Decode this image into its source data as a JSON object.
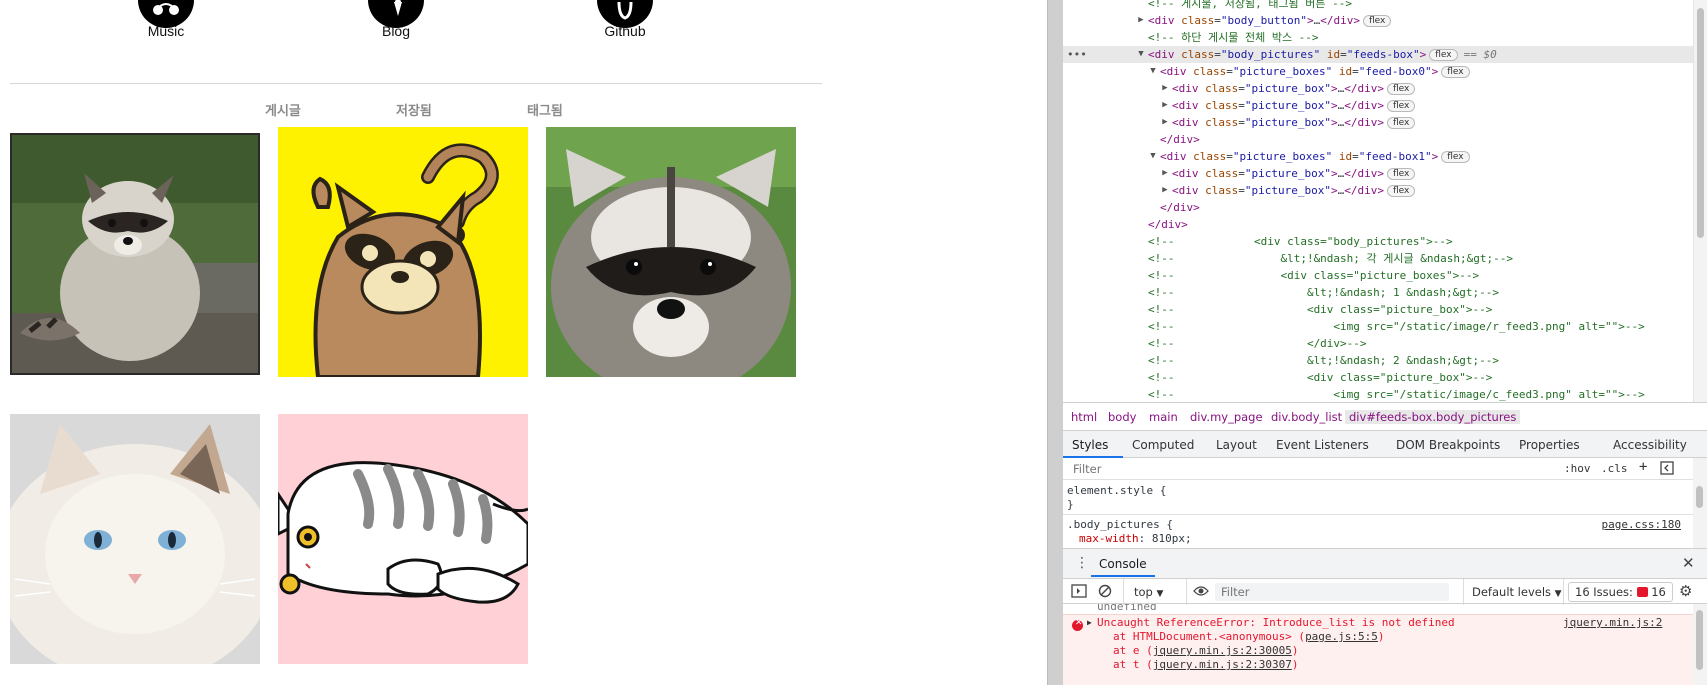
{
  "page": {
    "links": [
      {
        "label": "Music",
        "icon": "music-icon"
      },
      {
        "label": "Blog",
        "icon": "blog-icon"
      },
      {
        "label": "Github",
        "icon": "github-icon"
      }
    ],
    "tabs": [
      "게시글",
      "저장됨",
      "태그됨"
    ],
    "pictures": [
      {
        "subject": "raccoon-photo-icon",
        "bg": "#4f6b3a"
      },
      {
        "subject": "cartoon-raccoon-icon",
        "bg": "#fff200"
      },
      {
        "subject": "raccoon-face-photo-icon",
        "bg": "#5a8a3f"
      },
      {
        "subject": "white-cat-photo-icon",
        "bg": "#d9d9d9"
      },
      {
        "subject": "cartoon-cat-icon",
        "bg": "#ffd1d6"
      }
    ]
  },
  "devtools": {
    "dom_lines": [
      {
        "indent": 0,
        "kind": "comment",
        "text": "<!-- 게시물, 저장됨, 태그됨 버튼 -->"
      },
      {
        "indent": 0,
        "kind": "node",
        "tri": "▶",
        "tag": "div",
        "class": "body_button",
        "id": "",
        "suffix": "…</div>",
        "badge": "flex"
      },
      {
        "indent": 0,
        "kind": "comment",
        "text": "<!-- 하단 게시물 전체 박스 -->"
      },
      {
        "indent": 0,
        "kind": "node",
        "tri": "▼",
        "tag": "div",
        "class": "body_pictures",
        "id": "feeds-box",
        "suffix": "",
        "badge": "flex",
        "selected": true,
        "eq": "== $0"
      },
      {
        "indent": 1,
        "kind": "node",
        "tri": "▼",
        "tag": "div",
        "class": "picture_boxes",
        "id": "feed-box0",
        "suffix": "",
        "badge": "flex"
      },
      {
        "indent": 2,
        "kind": "node",
        "tri": "▶",
        "tag": "div",
        "class": "picture_box",
        "id": "",
        "suffix": "…</div>",
        "badge": "flex"
      },
      {
        "indent": 2,
        "kind": "node",
        "tri": "▶",
        "tag": "div",
        "class": "picture_box",
        "id": "",
        "suffix": "…</div>",
        "badge": "flex"
      },
      {
        "indent": 2,
        "kind": "node",
        "tri": "▶",
        "tag": "div",
        "class": "picture_box",
        "id": "",
        "suffix": "…</div>",
        "badge": "flex"
      },
      {
        "indent": 1,
        "kind": "close",
        "text": "</div>"
      },
      {
        "indent": 1,
        "kind": "node",
        "tri": "▼",
        "tag": "div",
        "class": "picture_boxes",
        "id": "feed-box1",
        "suffix": "",
        "badge": "flex"
      },
      {
        "indent": 2,
        "kind": "node",
        "tri": "▶",
        "tag": "div",
        "class": "picture_box",
        "id": "",
        "suffix": "…</div>",
        "badge": "flex"
      },
      {
        "indent": 2,
        "kind": "node",
        "tri": "▶",
        "tag": "div",
        "class": "picture_box",
        "id": "",
        "suffix": "…</div>",
        "badge": "flex"
      },
      {
        "indent": 1,
        "kind": "close",
        "text": "</div>"
      },
      {
        "indent": 0,
        "kind": "close",
        "text": "</div>"
      },
      {
        "indent": 0,
        "kind": "comment",
        "text": "<!--            <div class=\"body_pictures\">-->"
      },
      {
        "indent": 0,
        "kind": "comment",
        "text": "<!--                &lt;!&ndash; 각 게시글 &ndash;&gt;-->"
      },
      {
        "indent": 0,
        "kind": "comment",
        "text": "<!--                <div class=\"picture_boxes\">-->"
      },
      {
        "indent": 0,
        "kind": "comment",
        "text": "<!--                    &lt;!&ndash; 1 &ndash;&gt;-->"
      },
      {
        "indent": 0,
        "kind": "comment",
        "text": "<!--                    <div class=\"picture_box\">-->"
      },
      {
        "indent": 0,
        "kind": "comment",
        "text": "<!--                        <img src=\"/static/image/r_feed3.png\" alt=\"\">-->"
      },
      {
        "indent": 0,
        "kind": "comment",
        "text": "<!--                    </div>-->"
      },
      {
        "indent": 0,
        "kind": "comment",
        "text": "<!--                    &lt;!&ndash; 2 &ndash;&gt;-->"
      },
      {
        "indent": 0,
        "kind": "comment",
        "text": "<!--                    <div class=\"picture_box\">-->"
      },
      {
        "indent": 0,
        "kind": "comment",
        "text": "<!--                        <img src=\"/static/image/c_feed3.png\" alt=\"\">-->"
      }
    ],
    "breadcrumbs": [
      "html",
      "body",
      "main",
      "div.my_page",
      "div.body_list",
      "div#feeds-box.body_pictures"
    ],
    "style_tabs": [
      "Styles",
      "Computed",
      "Layout",
      "Event Listeners",
      "DOM Breakpoints",
      "Properties",
      "Accessibility"
    ],
    "filter_placeholder": "Filter",
    "filter_tools": [
      ":hov",
      ".cls",
      "+"
    ],
    "rules": {
      "element_style": "element.style {",
      "close_brace": "}",
      "selector": ".body_pictures {",
      "source": "page.css:180",
      "prop_name": "max-width",
      "prop_value": "810px;"
    },
    "drawer_tab": "Console",
    "console": {
      "context": "top",
      "filter_placeholder": "Filter",
      "levels": "Default levels",
      "issues_label": "16 Issues:",
      "issues_count": "16",
      "prev_line": "undefined",
      "error_message": "Uncaught ReferenceError: Introduce_list is not defined",
      "error_source": "jquery.min.js:2",
      "stack": [
        {
          "prefix": "at HTMLDocument.<anonymous> (",
          "link": "page.js:5:5",
          "suffix": ")"
        },
        {
          "prefix": "at e (",
          "link": "jquery.min.js:2:30005",
          "suffix": ")"
        },
        {
          "prefix": "at t (",
          "link": "jquery.min.js:2:30307",
          "suffix": ")"
        }
      ]
    },
    "colors": {
      "error": "#e4162e",
      "tag": "#881280",
      "attr": "#994500",
      "value": "#1a1aa6",
      "comment": "#236e25",
      "accent": "#1a73e8"
    }
  }
}
